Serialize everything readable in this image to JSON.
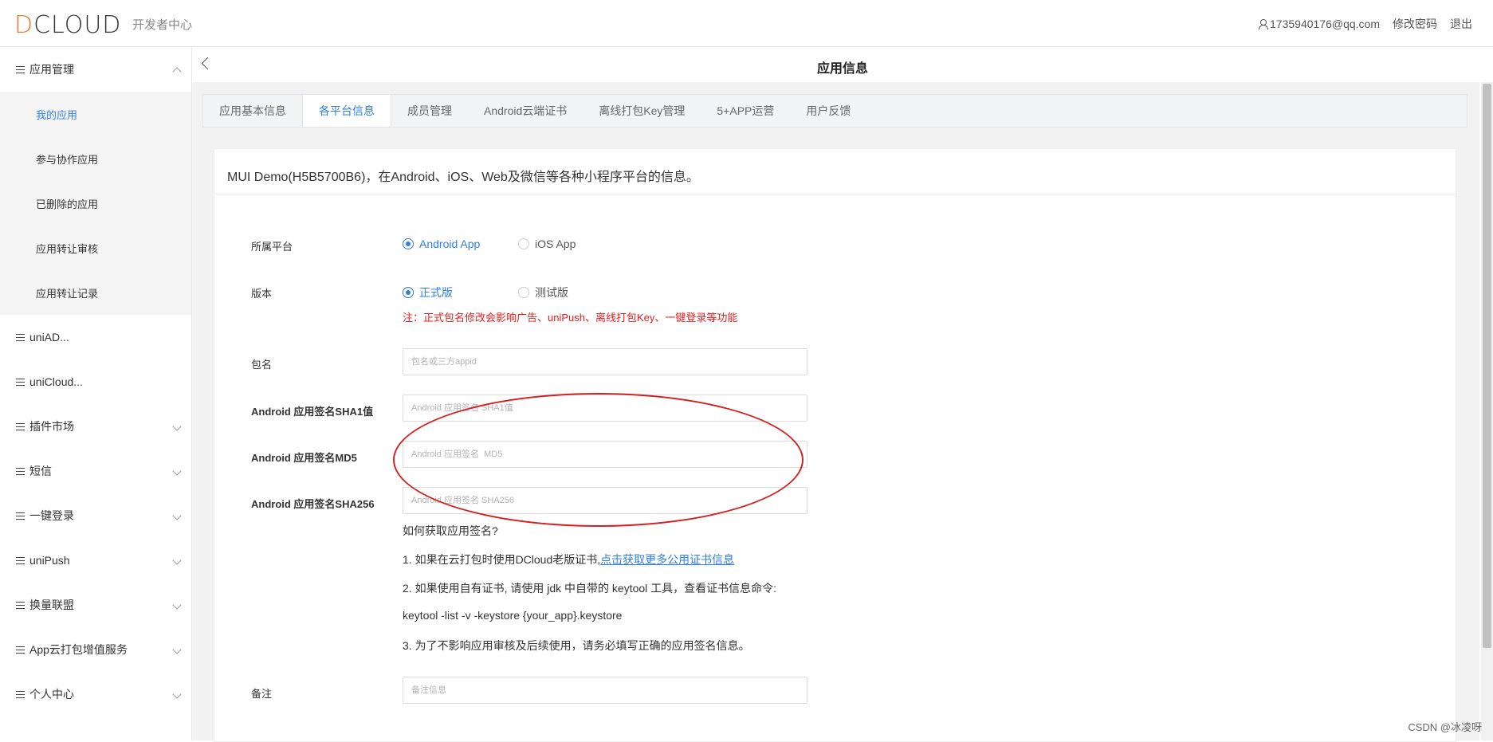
{
  "header": {
    "logo_d": "D",
    "logo_rest": "CLOUD",
    "logo_sub": "开发者中心",
    "user_email": "1735940176@qq.com",
    "change_password": "修改密码",
    "logout": "退出"
  },
  "sidebar": {
    "group_app": "应用管理",
    "sub_items": [
      "我的应用",
      "参与协作应用",
      "已删除的应用",
      "应用转让审核",
      "应用转让记录"
    ],
    "items": [
      "uniAD...",
      "uniCloud...",
      "插件市场",
      "短信",
      "一键登录",
      "uniPush",
      "换量联盟",
      "App云打包增值服务",
      "个人中心"
    ]
  },
  "page": {
    "title": "应用信息",
    "tabs": [
      "应用基本信息",
      "各平台信息",
      "成员管理",
      "Android云端证书",
      "离线打包Key管理",
      "5+APP运营",
      "用户反馈"
    ],
    "active_tab": "各平台信息",
    "card_title": "MUI Demo(H5B5700B6)，在Android、iOS、Web及微信等各种小程序平台的信息。"
  },
  "form": {
    "platform_label": "所属平台",
    "platform_android": "Android App",
    "platform_ios": "iOS App",
    "version_label": "版本",
    "version_release": "正式版",
    "version_test": "测试版",
    "version_note": "注：正式包名修改会影响广告、uniPush、离线打包Key、一键登录等功能",
    "package_label": "包名",
    "package_placeholder": "包名或三方appid",
    "sha1_label": "Android 应用签名SHA1值",
    "sha1_placeholder": "Android 应用签名 SHA1值",
    "md5_label": "Android 应用签名MD5",
    "md5_placeholder": "Android 应用签名  MD5",
    "sha256_label": "Android 应用签名SHA256",
    "sha256_placeholder": "Android 应用签名 SHA256",
    "help_title": "如何获取应用签名?",
    "help_1_text": "1. 如果在云打包时使用DCloud老版证书,",
    "help_1_link": "点击获取更多公用证书信息",
    "help_2": "2. 如果使用自有证书, 请使用 jdk 中自带的 keytool 工具，查看证书信息命令:",
    "help_cmd": "keytool -list -v -keystore {your_app}.keystore",
    "help_3": "3. 为了不影响应用审核及后续使用，请务必填写正确的应用签名信息。",
    "remark_label": "备注",
    "remark_placeholder": "备注信息"
  },
  "watermark": "CSDN @冰凌呀"
}
